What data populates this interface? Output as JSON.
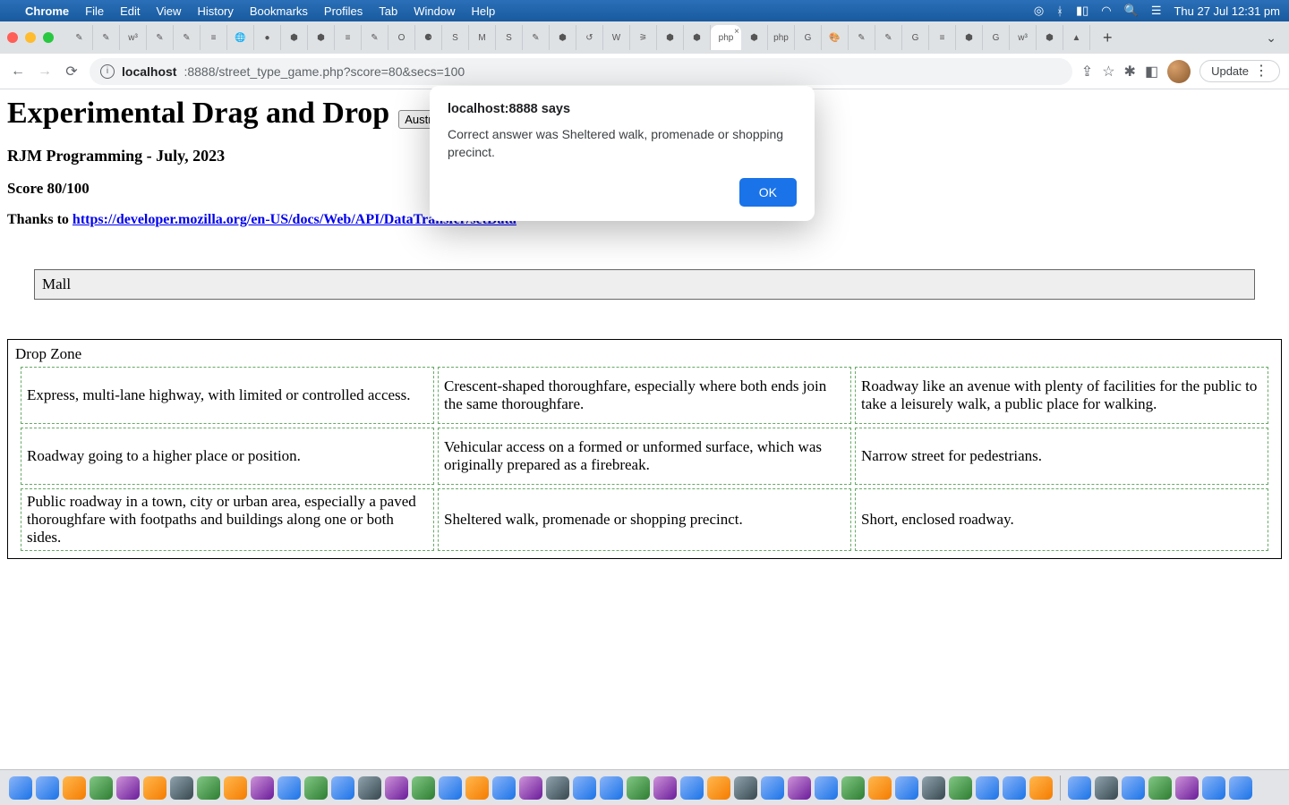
{
  "menubar": {
    "app": "Chrome",
    "items": [
      "File",
      "Edit",
      "View",
      "History",
      "Bookmarks",
      "Profiles",
      "Tab",
      "Window",
      "Help"
    ],
    "clock": "Thu 27 Jul  12:31 pm"
  },
  "toolbar": {
    "url_host": "localhost",
    "url_rest": ":8888/street_type_game.php?score=80&secs=100",
    "update_label": "Update"
  },
  "page": {
    "title": "Experimental Drag and Drop",
    "select_visible": "Australian S",
    "subtitle": "RJM Programming - July, 2023",
    "score": "Score 80/100",
    "thanks_prefix": "Thanks to ",
    "thanks_link": "https://developer.mozilla.org/en-US/docs/Web/API/DataTransfer/setData",
    "drag_item": "Mall",
    "dropzone_label": "Drop Zone",
    "cells": [
      "Express, multi-lane highway, with limited or controlled access.",
      "Crescent-shaped thoroughfare, especially where both ends join the same thoroughfare.",
      "Roadway like an avenue with plenty of facilities for the public to take a leisurely walk, a public place for walking.",
      "Roadway going to a higher place or position.",
      "Vehicular access on a formed or unformed surface, which was originally prepared as a firebreak.",
      "Narrow street for pedestrians.",
      "Public roadway in a town, city or urban area, especially a paved thoroughfare with footpaths and buildings along one or both sides.",
      "Sheltered walk, promenade or shopping precinct.",
      "Short, enclosed roadway."
    ]
  },
  "dialog": {
    "title": "localhost:8888 says",
    "message": "Correct answer was Sheltered walk, promenade or shopping precinct.",
    "ok": "OK"
  },
  "tabs": {
    "count": 38,
    "new_tab": "+"
  }
}
